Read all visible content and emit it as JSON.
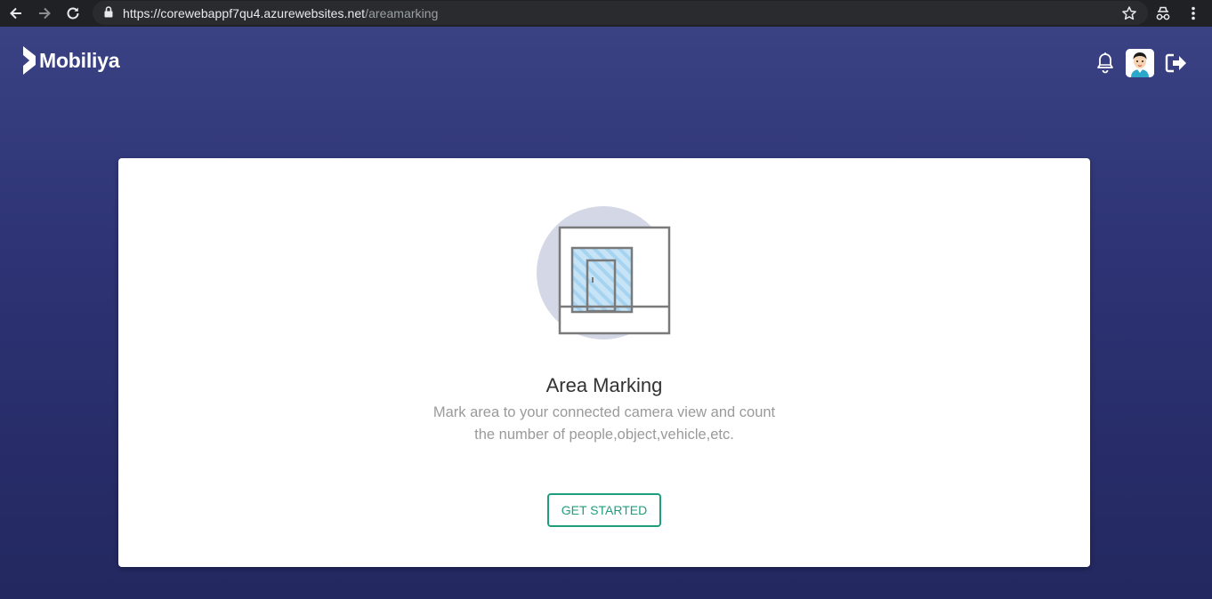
{
  "browser": {
    "url_host": "https://corewebappf7qu4.azurewebsites.net",
    "url_path": "/areamarking",
    "icons": [
      "back-arrow-icon",
      "forward-arrow-icon",
      "reload-icon",
      "lock-icon",
      "star-icon",
      "incognito-icon",
      "more-vert-icon"
    ]
  },
  "header": {
    "brand": "Mobiliya",
    "icons": [
      "notification-bell-icon",
      "user-avatar",
      "logout-icon"
    ]
  },
  "card": {
    "title": "Area Marking",
    "description_line1": "Mark area to your connected camera view and count",
    "description_line2": "the number of people,object,vehicle,etc.",
    "cta_label": "GET STARTED"
  },
  "colors": {
    "accent": "#1f9e7d",
    "header_bg": "#3a4284",
    "card_bg": "#ffffff"
  }
}
